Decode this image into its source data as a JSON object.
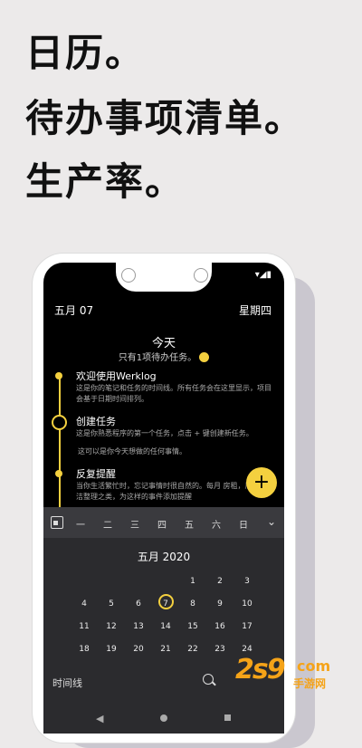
{
  "headlines": [
    "日历。",
    "待办事项清单。",
    "生产率。"
  ],
  "header": {
    "date": "五月 07",
    "weekday": "星期四"
  },
  "today": {
    "title": "今天",
    "subtitle": "只有1项待办任务。"
  },
  "timeline": [
    {
      "title": "欢迎使用Werklog",
      "body": "这是你的笔记和任务的时间线。所有任务会在这里显示，项目会基于日期时间排列。"
    },
    {
      "title": "创建任务",
      "body": "这是你熟悉程序的第一个任务，点击 + 键创建新任务。",
      "note": "这可以是你今天想做的任何事情。"
    },
    {
      "title": "反复提醒",
      "body": "当你生活繁忙时，忘记事情时很自然的。每月 房租，周末做清洁整理之类，为这样的事件添加提醒"
    }
  ],
  "fab_label": "+",
  "calendar": {
    "weekdays": [
      "一",
      "二",
      "三",
      "四",
      "五",
      "六",
      "日"
    ],
    "month_title": "五月 2020",
    "rows": [
      [
        "",
        "",
        "",
        "",
        "1",
        "2",
        "3"
      ],
      [
        "4",
        "5",
        "6",
        "7",
        "8",
        "9",
        "10"
      ],
      [
        "11",
        "12",
        "13",
        "14",
        "15",
        "16",
        "17"
      ],
      [
        "18",
        "19",
        "20",
        "21",
        "22",
        "23",
        "24"
      ]
    ],
    "selected_day": "7"
  },
  "bottom": {
    "label": "时间线"
  },
  "watermark": {
    "main": "2s9",
    "com": "com",
    "sub": "手游网"
  },
  "colors": {
    "accent": "#f4d03f",
    "watermark": "#f5a318"
  }
}
